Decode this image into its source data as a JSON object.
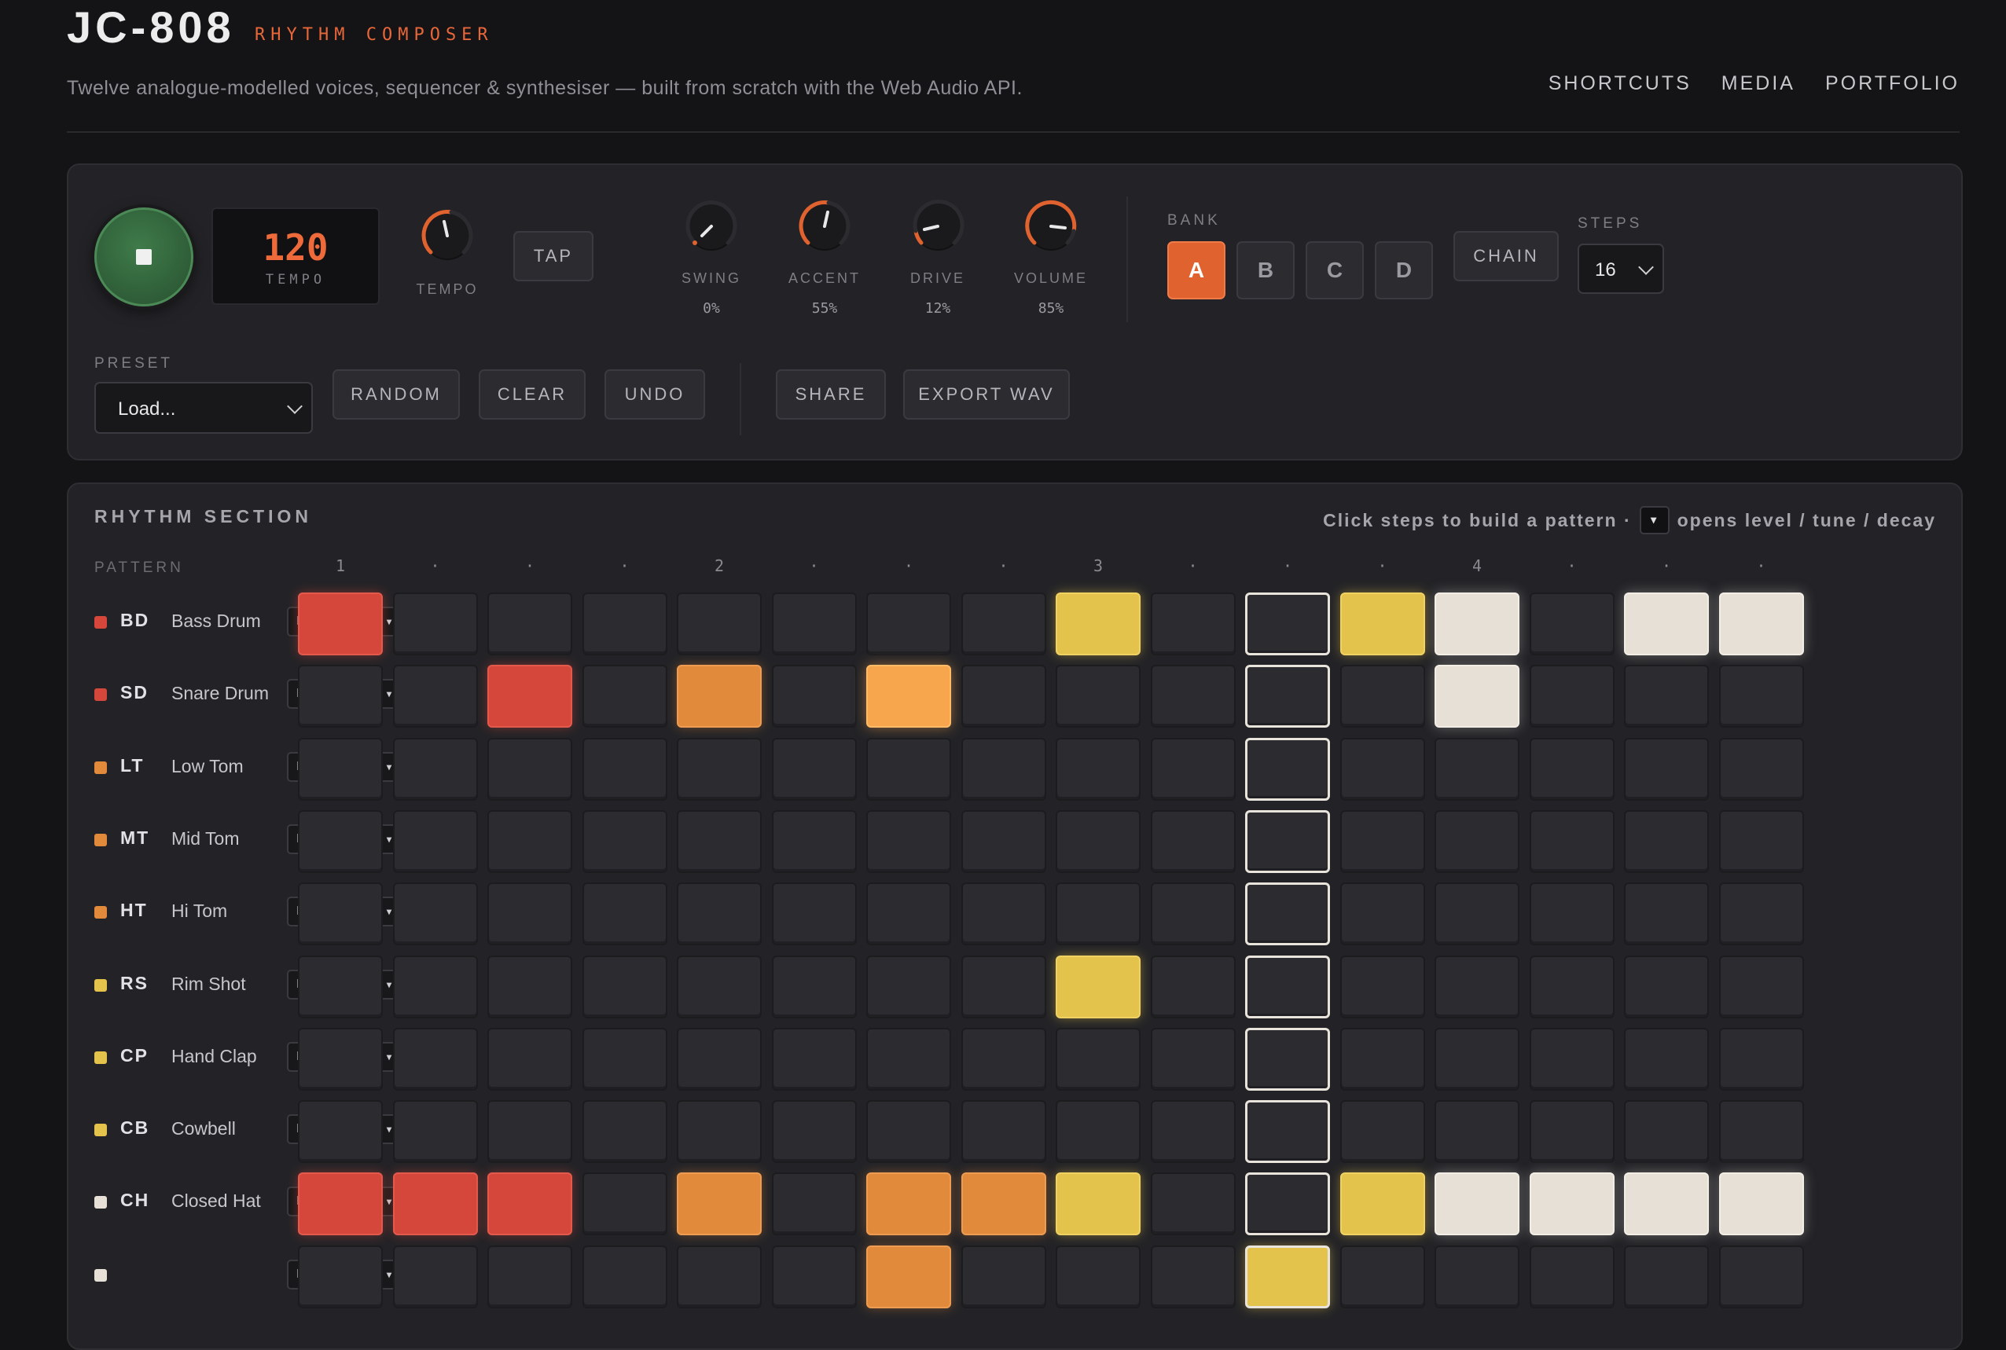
{
  "header": {
    "logo": "JC-808",
    "subtitle": "RHYTHM COMPOSER",
    "tagline": "Twelve analogue-modelled voices, sequencer & synthesiser — built from scratch with the Web Audio API.",
    "nav": [
      "SHORTCUTS",
      "MEDIA",
      "PORTFOLIO"
    ]
  },
  "transport": {
    "tempo_value": "120",
    "tempo_display_label": "TEMPO",
    "tempo_knob_label": "TEMPO",
    "tap_label": "TAP",
    "knobs": [
      {
        "label": "SWING",
        "value": "0%"
      },
      {
        "label": "ACCENT",
        "value": "55%"
      },
      {
        "label": "DRIVE",
        "value": "12%"
      },
      {
        "label": "VOLUME",
        "value": "85%"
      }
    ],
    "bank_label": "BANK",
    "banks": [
      "A",
      "B",
      "C",
      "D"
    ],
    "active_bank": "A",
    "chain_label": "CHAIN",
    "steps_label": "STEPS",
    "steps_value": "16",
    "preset_label": "PRESET",
    "preset_value": "Load...",
    "actions": [
      "RANDOM",
      "CLEAR",
      "UNDO"
    ],
    "share_label": "SHARE",
    "export_label": "EXPORT WAV",
    "colors": {
      "accent": "#e0622f",
      "play": "#3f7b4a"
    }
  },
  "rhythm": {
    "title": "RHYTHM SECTION",
    "hint_before": "Click steps to build a pattern ·",
    "hint_key": "▾",
    "hint_after": "opens level / tune / decay",
    "pattern_label": "PATTERN",
    "beat_markers": [
      "1",
      "·",
      "·",
      "·",
      "2",
      "·",
      "·",
      "·",
      "3",
      "·",
      "·",
      "·",
      "4",
      "·",
      "·",
      "·"
    ],
    "mute_label": "M",
    "solo_label": "S",
    "menu_label": "▾",
    "playhead_step": 10,
    "tracks": [
      {
        "code": "BD",
        "name": "Bass Drum",
        "color": "#d5463b",
        "steps": [
          "red",
          "",
          "",
          "",
          "",
          "",
          "",
          "",
          "yellow",
          "",
          "",
          "yellow",
          "cream",
          "",
          "cream",
          "cream"
        ]
      },
      {
        "code": "SD",
        "name": "Snare Drum",
        "color": "#d5463b",
        "steps": [
          "",
          "",
          "red",
          "",
          "orange",
          "",
          "amber",
          "",
          "",
          "",
          "",
          "",
          "cream",
          "",
          "",
          ""
        ]
      },
      {
        "code": "LT",
        "name": "Low Tom",
        "color": "#e28a3c",
        "steps": [
          "",
          "",
          "",
          "",
          "",
          "",
          "",
          "",
          "",
          "",
          "",
          "",
          "",
          "",
          "",
          ""
        ]
      },
      {
        "code": "MT",
        "name": "Mid Tom",
        "color": "#e28a3c",
        "steps": [
          "",
          "",
          "",
          "",
          "",
          "",
          "",
          "",
          "",
          "",
          "",
          "",
          "",
          "",
          "",
          ""
        ]
      },
      {
        "code": "HT",
        "name": "Hi Tom",
        "color": "#e28a3c",
        "steps": [
          "",
          "",
          "",
          "",
          "",
          "",
          "",
          "",
          "",
          "",
          "",
          "",
          "",
          "",
          "",
          ""
        ]
      },
      {
        "code": "RS",
        "name": "Rim Shot",
        "color": "#e4c34c",
        "steps": [
          "",
          "",
          "",
          "",
          "",
          "",
          "",
          "",
          "yellow",
          "",
          "",
          "",
          "",
          "",
          "",
          ""
        ]
      },
      {
        "code": "CP",
        "name": "Hand Clap",
        "color": "#e4c34c",
        "steps": [
          "",
          "",
          "",
          "",
          "",
          "",
          "",
          "",
          "",
          "",
          "",
          "",
          "",
          "",
          "",
          ""
        ]
      },
      {
        "code": "CB",
        "name": "Cowbell",
        "color": "#e4c34c",
        "steps": [
          "",
          "",
          "",
          "",
          "",
          "",
          "",
          "",
          "",
          "",
          "",
          "",
          "",
          "",
          "",
          ""
        ]
      },
      {
        "code": "CH",
        "name": "Closed Hat",
        "color": "#e6e0d6",
        "steps": [
          "red",
          "red",
          "red",
          "",
          "orange",
          "",
          "orange",
          "orange",
          "yellow",
          "",
          "",
          "yellow",
          "cream",
          "cream",
          "cream",
          "cream"
        ]
      },
      {
        "code": "",
        "name": "",
        "color": "#e6e0d6",
        "steps": [
          "",
          "",
          "",
          "",
          "",
          "",
          "orange",
          "",
          "",
          "",
          "yellow",
          "",
          "",
          "",
          "",
          ""
        ]
      }
    ]
  }
}
